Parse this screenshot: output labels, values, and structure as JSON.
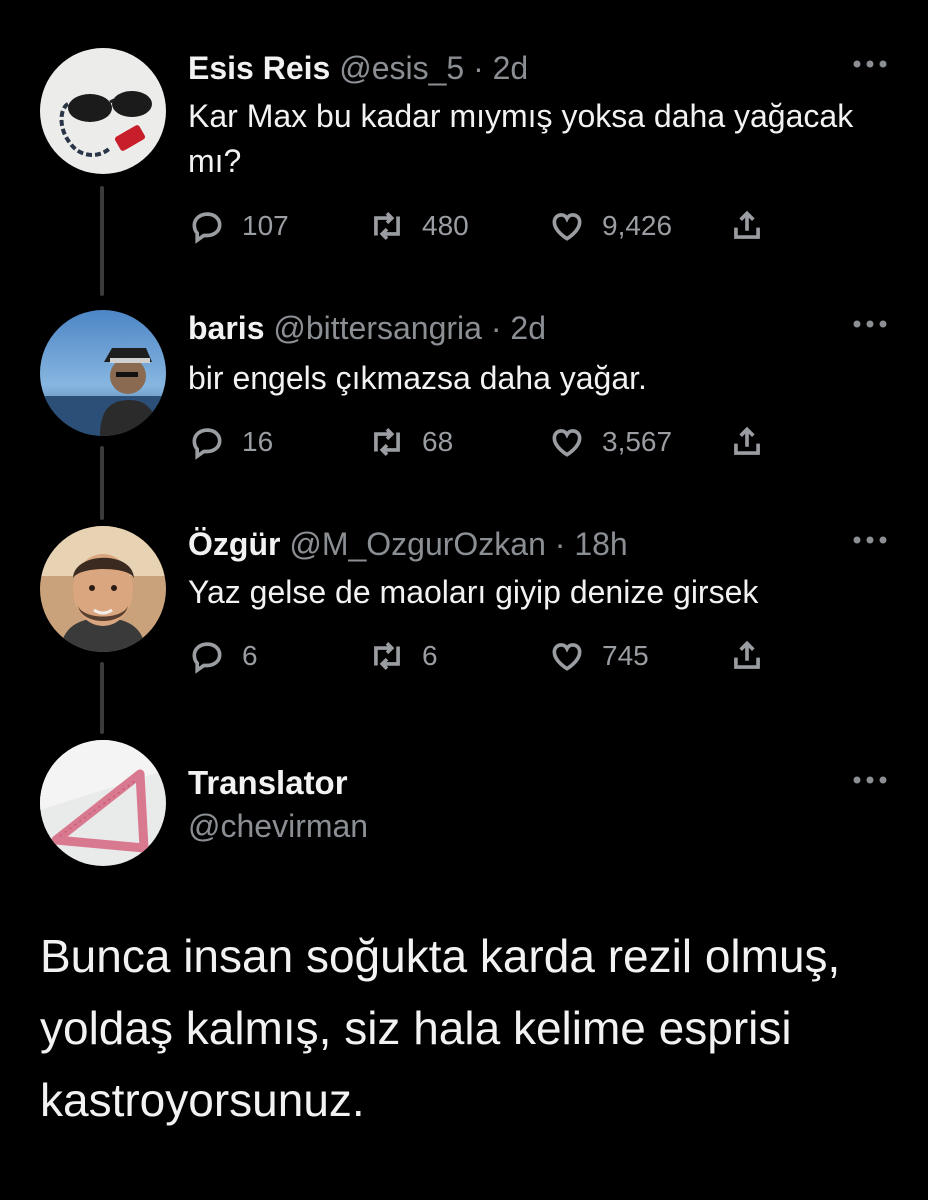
{
  "tweets": [
    {
      "name": "Esis Reis",
      "handle": "@esis_5",
      "separator": "·",
      "time": "2d",
      "text": "Kar Max bu kadar mıymış yoksa daha yağacak mı?",
      "replies": "107",
      "retweets": "480",
      "likes": "9,426"
    },
    {
      "name": "baris",
      "handle": "@bittersangria",
      "separator": "·",
      "time": "2d",
      "text": "bir engels çıkmazsa daha yağar.",
      "replies": "16",
      "retweets": "68",
      "likes": "3,567"
    },
    {
      "name": "Özgür",
      "handle": "@M_OzgurOzkan",
      "separator": "·",
      "time": "18h",
      "text": "Yaz gelse de maoları giyip denize girsek",
      "replies": "6",
      "retweets": "6",
      "likes": "745"
    }
  ],
  "main_tweet": {
    "name": "Translator",
    "handle": "@chevirman",
    "text": "Bunca insan soğukta karda rezil olmuş, yoldaş kalmış, siz hala kelime esprisi kastroyorsunuz."
  },
  "icons": {
    "reply": "reply-icon",
    "retweet": "retweet-icon",
    "like": "like-icon",
    "share": "share-icon",
    "more": "more-icon"
  }
}
